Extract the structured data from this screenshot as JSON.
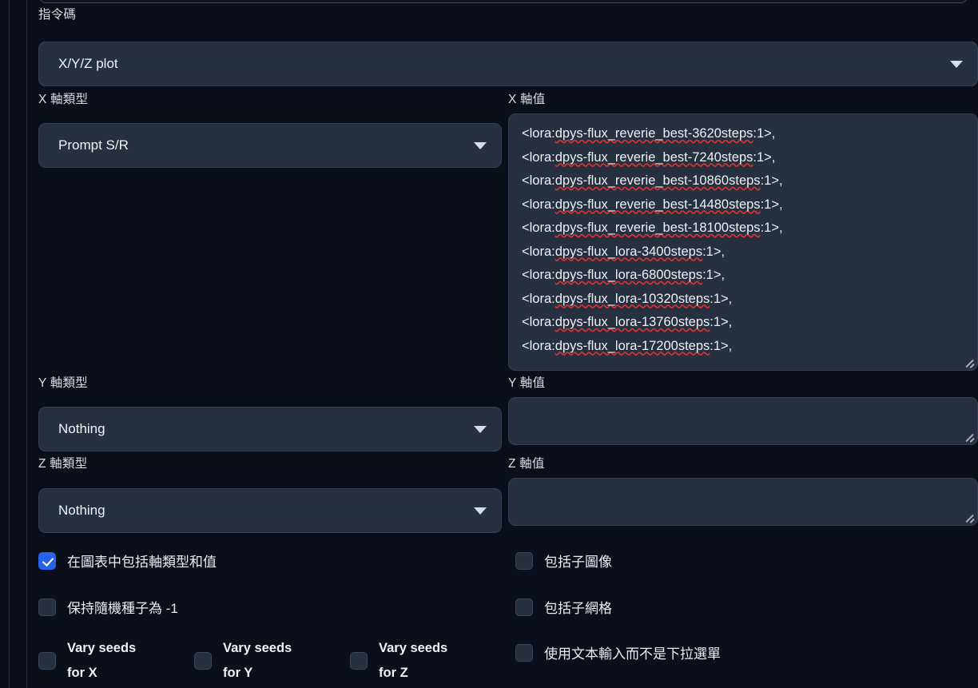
{
  "script": {
    "label": "指令碼",
    "selected": "X/Y/Z plot",
    "caret_icon": "chevron-down-icon"
  },
  "axes": {
    "x": {
      "type_label": "X 軸類型",
      "type_value": "Prompt S/R",
      "values_label": "X 軸值",
      "values_lines": [
        "<lora:dpys-flux_reverie_best-3620steps:1>,",
        "<lora:dpys-flux_reverie_best-7240steps:1>,",
        "<lora:dpys-flux_reverie_best-10860steps:1>,",
        "<lora:dpys-flux_reverie_best-14480steps:1>,",
        "<lora:dpys-flux_reverie_best-18100steps:1>,",
        "<lora:dpys-flux_lora-3400steps:1>,",
        "<lora:dpys-flux_lora-6800steps:1>,",
        "<lora:dpys-flux_lora-10320steps:1>,",
        "<lora:dpys-flux_lora-13760steps:1>,",
        "<lora:dpys-flux_lora-17200steps:1>,"
      ]
    },
    "y": {
      "type_label": "Y 軸類型",
      "type_value": "Nothing",
      "values_label": "Y 軸值",
      "values_text": ""
    },
    "z": {
      "type_label": "Z 軸類型",
      "type_value": "Nothing",
      "values_label": "Z 軸值",
      "values_text": ""
    }
  },
  "options": {
    "include_axis_types_and_values": {
      "label": "在圖表中包括軸類型和值",
      "checked": true
    },
    "keep_seed_minus_one": {
      "label": "保持隨機種子為 -1",
      "checked": false
    },
    "include_sub_images": {
      "label": "包括子圖像",
      "checked": false
    },
    "include_sub_grids": {
      "label": "包括子網格",
      "checked": false
    },
    "use_text_inputs": {
      "label": "使用文本輸入而不是下拉選單",
      "checked": false
    },
    "vary_seeds_x": {
      "label": "Vary seeds\nfor X",
      "checked": false
    },
    "vary_seeds_y": {
      "label": "Vary seeds\nfor Y",
      "checked": false
    },
    "vary_seeds_z": {
      "label": "Vary seeds\nfor Z",
      "checked": false
    }
  },
  "theme": {
    "background": "#0b0f19",
    "field_background": "#27303f",
    "field_border": "#364052",
    "accent": "#2563eb",
    "text": "#e6e8ee",
    "squiggle": "#e03131"
  }
}
